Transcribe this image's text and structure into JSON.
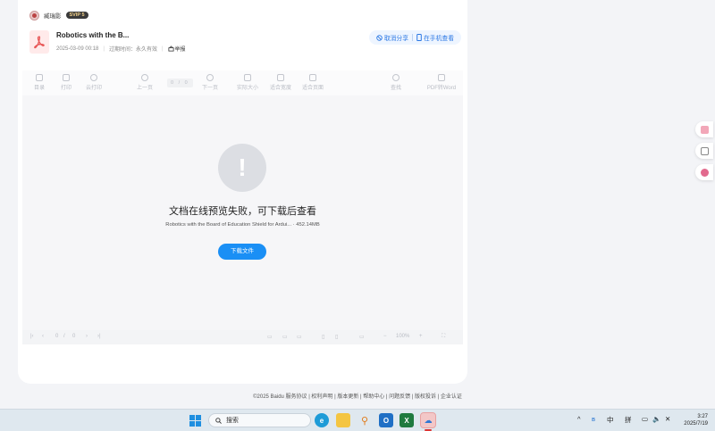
{
  "header": {
    "username": "臧瑞影",
    "vip_badge": "SVIP 5"
  },
  "file": {
    "name": "Robotics with the B...",
    "date": "2025-03-09 00:18",
    "expiry": "过期时间：永久有效",
    "report": "举报",
    "cancel_share": "取消分享",
    "view_on_phone": "在手机查看"
  },
  "toolbar": {
    "catalog": "目录",
    "print": "打印",
    "cloud_print": "云打印",
    "prev_page": "上一页",
    "page_indicator": "0 / 0",
    "next_page": "下一页",
    "actual_size": "实际大小",
    "fit_width": "适合宽度",
    "fit_page": "适合页面",
    "search": "查找",
    "pdf_to_word": "PDF转Word"
  },
  "viewer": {
    "error_title": "文档在线预览失败，可下载后查看",
    "error_file": "Robotics with the Board of Education Shield for Ardui...",
    "error_size": "· 452.14MB",
    "download_button": "下载文件"
  },
  "bottombar": {
    "page_current": "0",
    "page_sep": "/",
    "page_total": "0",
    "zoom": "100%"
  },
  "footer": {
    "text": "©2025 Baidu  服务协议 | 权利声明 | 版本更新 | 帮助中心 | 问题反馈 | 版权投诉 | 企业认证"
  },
  "taskbar": {
    "search_placeholder": "搜索",
    "ime_lang": "中",
    "ime_mode": "拼",
    "time": "3:27",
    "date": "2025/7/19"
  },
  "colors": {
    "accent": "#1a8ff5",
    "link_blue": "#2b78e4",
    "pdf_red": "#e85656"
  }
}
